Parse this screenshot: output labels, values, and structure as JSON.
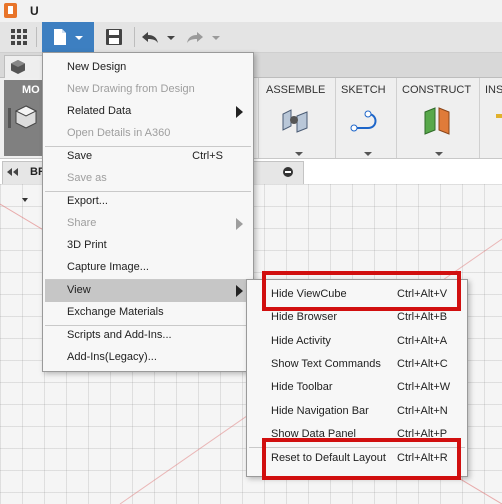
{
  "colors": {
    "accent": "#3d7fc1",
    "highlight_box": "#d10f0f",
    "logo": "#e8742a"
  },
  "icons": {
    "app": "fusion-logo-icon",
    "grid": "grid-icon",
    "file": "document-icon",
    "save": "save-icon",
    "undo": "undo-icon",
    "redo": "redo-icon"
  },
  "tab": {
    "label": "U"
  },
  "ribbon": {
    "workspace_label": "MO",
    "groups": [
      {
        "label": "ASSEMBLE"
      },
      {
        "label": "SKETCH"
      },
      {
        "label": "CONSTRUCT"
      },
      {
        "label": "INS"
      }
    ]
  },
  "browser": {
    "label": "BR"
  },
  "file_menu": {
    "items": [
      {
        "label": "New Design",
        "shortcut": "",
        "disabled": false,
        "submenu": false
      },
      {
        "label": "New Drawing from Design",
        "shortcut": "",
        "disabled": true,
        "submenu": false
      },
      {
        "label": "Related Data",
        "shortcut": "",
        "disabled": false,
        "submenu": true
      },
      {
        "label": "Open Details in A360",
        "shortcut": "",
        "disabled": true,
        "submenu": false
      },
      {
        "label": "Save",
        "shortcut": "Ctrl+S",
        "disabled": false,
        "submenu": false
      },
      {
        "label": "Save as",
        "shortcut": "",
        "disabled": true,
        "submenu": false
      },
      {
        "label": "Export...",
        "shortcut": "",
        "disabled": false,
        "submenu": false
      },
      {
        "label": "Share",
        "shortcut": "",
        "disabled": true,
        "submenu": true
      },
      {
        "label": "3D Print",
        "shortcut": "",
        "disabled": false,
        "submenu": false
      },
      {
        "label": "Capture Image...",
        "shortcut": "",
        "disabled": false,
        "submenu": false
      },
      {
        "label": "View",
        "shortcut": "",
        "disabled": false,
        "submenu": true,
        "highlighted": true
      },
      {
        "label": "Exchange Materials",
        "shortcut": "",
        "disabled": false,
        "submenu": false
      },
      {
        "label": "Scripts and Add-Ins...",
        "shortcut": "",
        "disabled": false,
        "submenu": false
      },
      {
        "label": "Add-Ins(Legacy)...",
        "shortcut": "",
        "disabled": false,
        "submenu": false
      }
    ]
  },
  "view_submenu": {
    "items": [
      {
        "label": "Hide ViewCube",
        "shortcut": "Ctrl+Alt+V",
        "boxed": true
      },
      {
        "label": "Hide Browser",
        "shortcut": "Ctrl+Alt+B"
      },
      {
        "label": "Hide Activity",
        "shortcut": "Ctrl+Alt+A"
      },
      {
        "label": "Show Text Commands",
        "shortcut": "Ctrl+Alt+C"
      },
      {
        "label": "Hide Toolbar",
        "shortcut": "Ctrl+Alt+W"
      },
      {
        "label": "Hide Navigation Bar",
        "shortcut": "Ctrl+Alt+N"
      },
      {
        "label": "Show Data Panel",
        "shortcut": "Ctrl+Alt+P"
      },
      {
        "label": "Reset to Default Layout",
        "shortcut": "Ctrl+Alt+R",
        "boxed": true
      }
    ]
  }
}
